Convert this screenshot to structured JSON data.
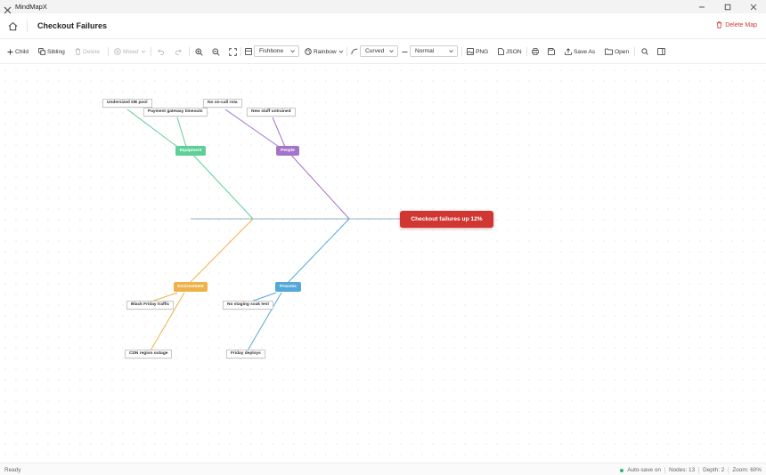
{
  "window": {
    "app_name": "MindMapX"
  },
  "header": {
    "title": "Checkout Failures",
    "delete_label": "Delete Map"
  },
  "toolbar": {
    "child": "Child",
    "sibling": "Sibling",
    "delete": "Delete",
    "mixed": "Mixed",
    "layout": "Fishbone",
    "theme": "Rainbow",
    "line_style": "Curved",
    "spacing": "Normal",
    "export_png": "PNG",
    "export_json": "JSON",
    "save_as": "Save As",
    "open": "Open"
  },
  "map": {
    "root": "Checkout failures up 12%",
    "categories": [
      {
        "label": "Equipment",
        "color": "#5fcf98"
      },
      {
        "label": "People",
        "color": "#a474c9"
      },
      {
        "label": "Environment",
        "color": "#eeb24a"
      },
      {
        "label": "Process",
        "color": "#55a8d8"
      }
    ],
    "causes": {
      "equipment": [
        "Undersized DB pool",
        "Payment gateway timeouts"
      ],
      "people": [
        "No on-call rota",
        "New staff untrained"
      ],
      "environment": [
        "Black Friday traffic",
        "CDN region outage"
      ],
      "process": [
        "No staging soak test",
        "Friday deploys"
      ]
    },
    "spine_color": "#8fb3c6"
  },
  "status": {
    "left": "Ready",
    "autosave": "Auto-save on",
    "nodes": "Nodes: 13",
    "depth": "Depth: 2",
    "zoom": "Zoom: 60%"
  }
}
